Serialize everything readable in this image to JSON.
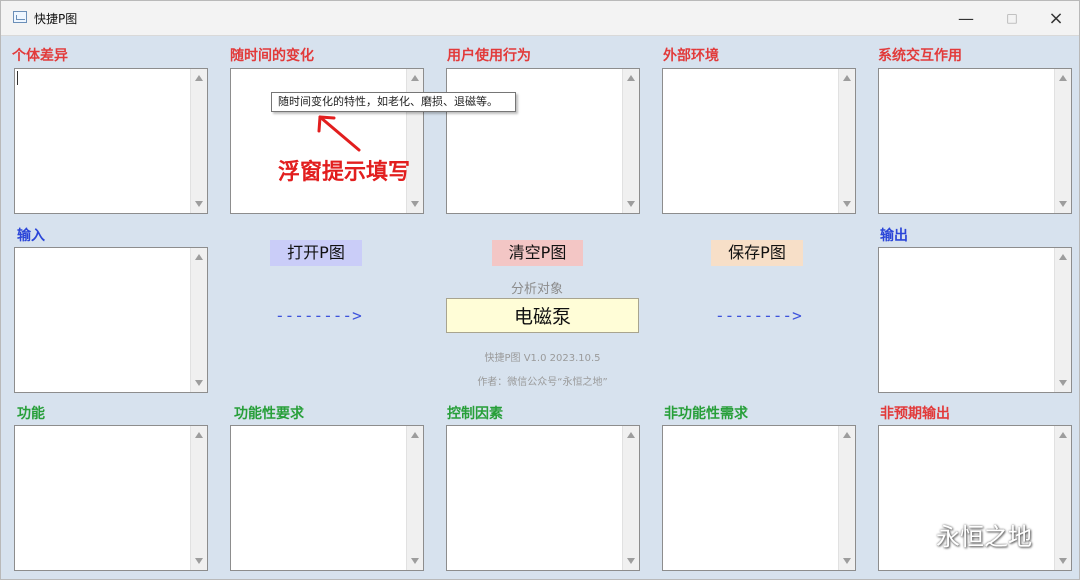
{
  "window": {
    "title": "快捷P图",
    "controls": {
      "minimize": "—",
      "maximize": "□",
      "close": "×"
    }
  },
  "panels": {
    "individual_difference": {
      "label": "个体差异",
      "value": ""
    },
    "time_change": {
      "label": "随时间的变化",
      "value": ""
    },
    "user_behavior": {
      "label": "用户使用行为",
      "value": ""
    },
    "external_environment": {
      "label": "外部环境",
      "value": ""
    },
    "system_interaction": {
      "label": "系统交互作用",
      "value": ""
    },
    "input": {
      "label": "输入",
      "value": ""
    },
    "output": {
      "label": "输出",
      "value": ""
    },
    "function": {
      "label": "功能",
      "value": ""
    },
    "functional_requirement": {
      "label": "功能性要求",
      "value": ""
    },
    "control_factor": {
      "label": "控制因素",
      "value": ""
    },
    "nonfunctional_requirement": {
      "label": "非功能性需求",
      "value": ""
    },
    "unexpected_output": {
      "label": "非预期输出",
      "value": ""
    }
  },
  "tooltip": {
    "text": "随时间变化的特性，如老化、磨损、退磁等。"
  },
  "annotation": {
    "text": "浮窗提示填写"
  },
  "buttons": {
    "open": "打开P图",
    "clear": "清空P图",
    "save": "保存P图"
  },
  "flow_arrows": {
    "left": "-------->",
    "right": "-------->"
  },
  "analysis": {
    "label": "分析对象",
    "value": "电磁泵"
  },
  "info": {
    "version": "快捷P图 V1.0 2023.10.5",
    "author": "作者：微信公众号“永恒之地”"
  },
  "watermark": {
    "text": "永恒之地"
  },
  "colors": {
    "red_label": "#e23a3a",
    "blue_label": "#2b46d8",
    "green_label": "#279f39",
    "open_button": "#cacdf8",
    "clear_button": "#f3c6c5",
    "save_button": "#f7dfc8",
    "analysis_field": "#fffdd7"
  },
  "icons": {
    "app": "picture-icon",
    "annotation": "red-arrow-icon",
    "watermark": "wechat-icon"
  }
}
